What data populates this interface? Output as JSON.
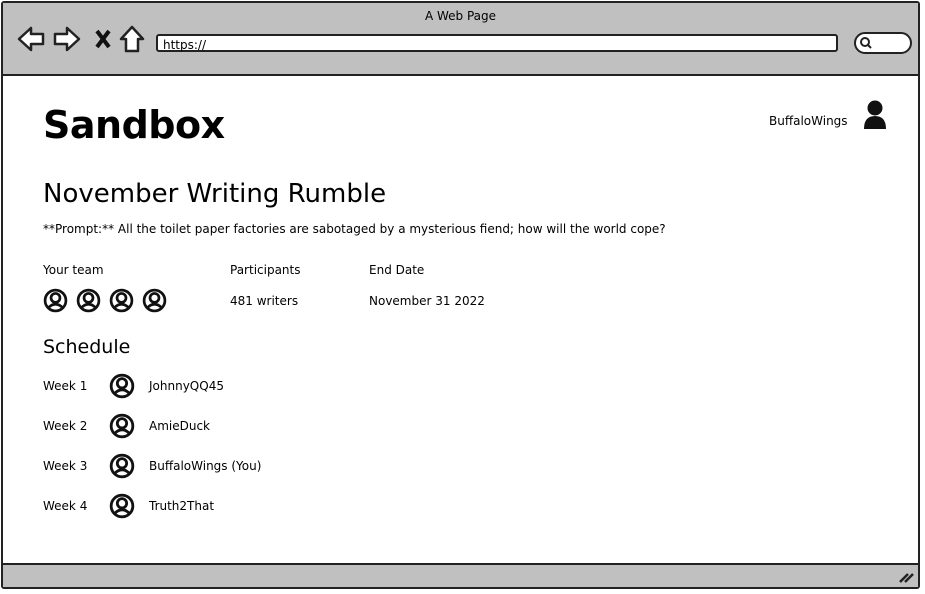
{
  "browser": {
    "title": "A Web Page",
    "url": "https://",
    "icons": [
      "back-arrow-icon",
      "forward-arrow-icon",
      "close-x-icon",
      "home-icon",
      "search-icon"
    ]
  },
  "header": {
    "logo": "Sandbox",
    "username": "BuffaloWings",
    "avatar_icon": "user-icon"
  },
  "contest": {
    "title": "November Writing Rumble",
    "prompt": "**Prompt:** All the toilet paper factories are sabotaged by a mysterious fiend; how will the world cope?"
  },
  "info": {
    "team_label": "Your team",
    "participants_label": "Participants",
    "participants_value": "481 writers",
    "end_date_label": "End Date",
    "end_date_value": "November 31 2022"
  },
  "schedule": {
    "title": "Schedule",
    "rows": [
      {
        "week": "Week 1",
        "name": "JohnnyQQ45"
      },
      {
        "week": "Week 2",
        "name": "AmieDuck"
      },
      {
        "week": "Week 3",
        "name": "BuffaloWings (You)"
      },
      {
        "week": "Week 4",
        "name": "Truth2That"
      }
    ]
  }
}
